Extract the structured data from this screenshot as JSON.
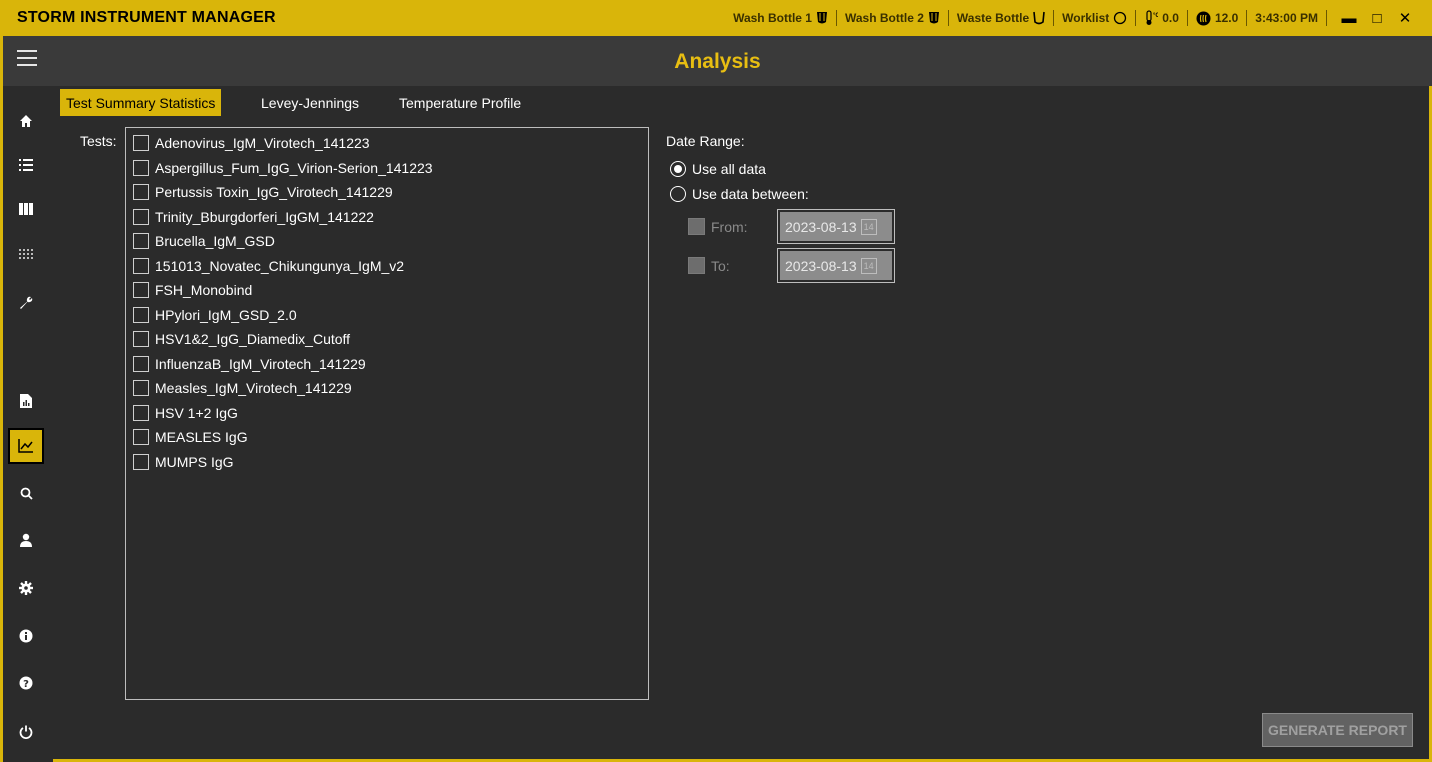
{
  "app": {
    "title": "STORM INSTRUMENT MANAGER"
  },
  "status": {
    "wash1": "Wash Bottle 1",
    "wash2": "Wash Bottle 2",
    "waste": "Waste Bottle",
    "worklist": "Worklist",
    "temp": "0.0",
    "reagent": "12.0",
    "time": "3:43:00 PM"
  },
  "window_controls": {
    "minimize": "▬",
    "maximize": "□",
    "close": "✕"
  },
  "header": {
    "title": "Analysis"
  },
  "tabs": [
    {
      "label": "Test Summary Statistics",
      "active": true
    },
    {
      "label": "Levey-Jennings",
      "active": false
    },
    {
      "label": "Temperature Profile",
      "active": false
    }
  ],
  "tests": {
    "label": "Tests:",
    "items": [
      "Adenovirus_IgM_Virotech_141223",
      "Aspergillus_Fum_IgG_Virion-Serion_141223",
      "Pertussis Toxin_IgG_Virotech_141229",
      "Trinity_Bburgdorferi_IgGM_141222",
      "Brucella_IgM_GSD",
      "151013_Novatec_Chikungunya_IgM_v2",
      "FSH_Monobind",
      "HPylori_IgM_GSD_2.0",
      "HSV1&2_IgG_Diamedix_Cutoff",
      "InfluenzaB_IgM_Virotech_141229",
      "Measles_IgM_Virotech_141229",
      "HSV 1+2 IgG",
      "MEASLES IgG",
      "MUMPS IgG"
    ]
  },
  "date_range": {
    "label": "Date Range:",
    "use_all": "Use all data",
    "use_between": "Use data between:",
    "from_label": "From:",
    "from_value": "2023-08-13",
    "to_label": "To:",
    "to_value": "2023-08-13"
  },
  "generate_button": "GENERATE REPORT",
  "colors": {
    "accent": "#d9b50a",
    "title": "#e8be12",
    "background": "#2b2b2b"
  }
}
